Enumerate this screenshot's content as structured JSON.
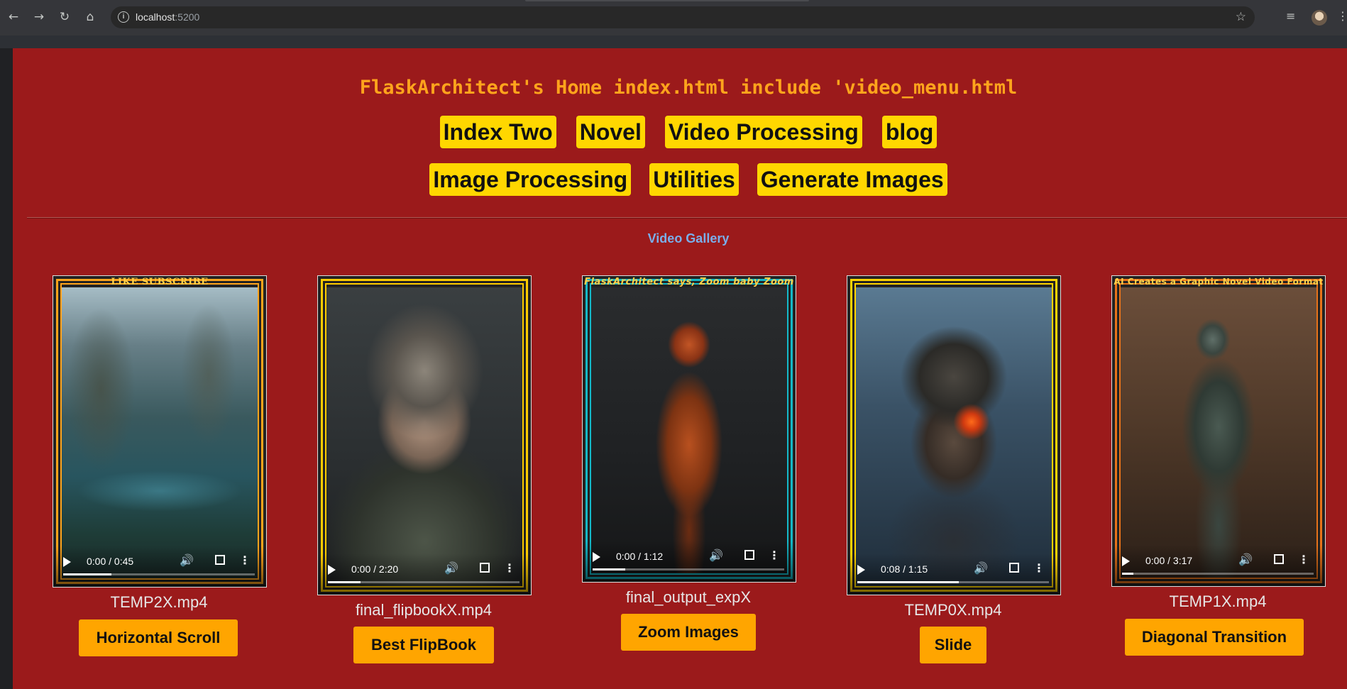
{
  "browser": {
    "url_host": "localhost",
    "url_port": ":5200"
  },
  "page": {
    "title": "FlaskArchitect's Home index.html include 'video_menu.html",
    "menu_row1": [
      "Index Two",
      "Novel",
      "Video Processing",
      "blog"
    ],
    "menu_row2": [
      "Image Processing",
      "Utilities",
      "Generate Images"
    ],
    "gallery_title": "Video Gallery"
  },
  "videos": [
    {
      "filename": "TEMP2X.mp4",
      "time": "0:00 / 0:45",
      "progress": 0.25,
      "button": "Horizontal Scroll",
      "banner": "LIKE        SUBSCRIBE",
      "frame_color": "#ffa41c",
      "banner_color": "#ffd24a"
    },
    {
      "filename": "final_flipbookX.mp4",
      "time": "0:00 / 2:20",
      "progress": 0.17,
      "button": "Best FlipBook",
      "banner": "",
      "frame_color": "#ffcc00",
      "banner_color": "#ffcc00"
    },
    {
      "filename": "final_output_expX",
      "time": "0:00 / 1:12",
      "progress": 0.17,
      "button": "Zoom Images",
      "banner": "FlaskArchitect says, Zoom baby Zoom",
      "frame_color": "#14b8c8",
      "banner_color": "#ffd24a"
    },
    {
      "filename": "TEMP0X.mp4",
      "time": "0:08 / 1:15",
      "progress": 0.53,
      "button": "Slide",
      "banner": "",
      "frame_color": "#ffd400",
      "banner_color": "#ffd400"
    },
    {
      "filename": "TEMP1X.mp4",
      "time": "0:00 / 3:17",
      "progress": 0.06,
      "button": "Diagonal Transition",
      "banner": "AI Creates a Graphic Novel Video Format",
      "frame_color": "#e8731a",
      "banner_color": "#ffd24a"
    }
  ]
}
